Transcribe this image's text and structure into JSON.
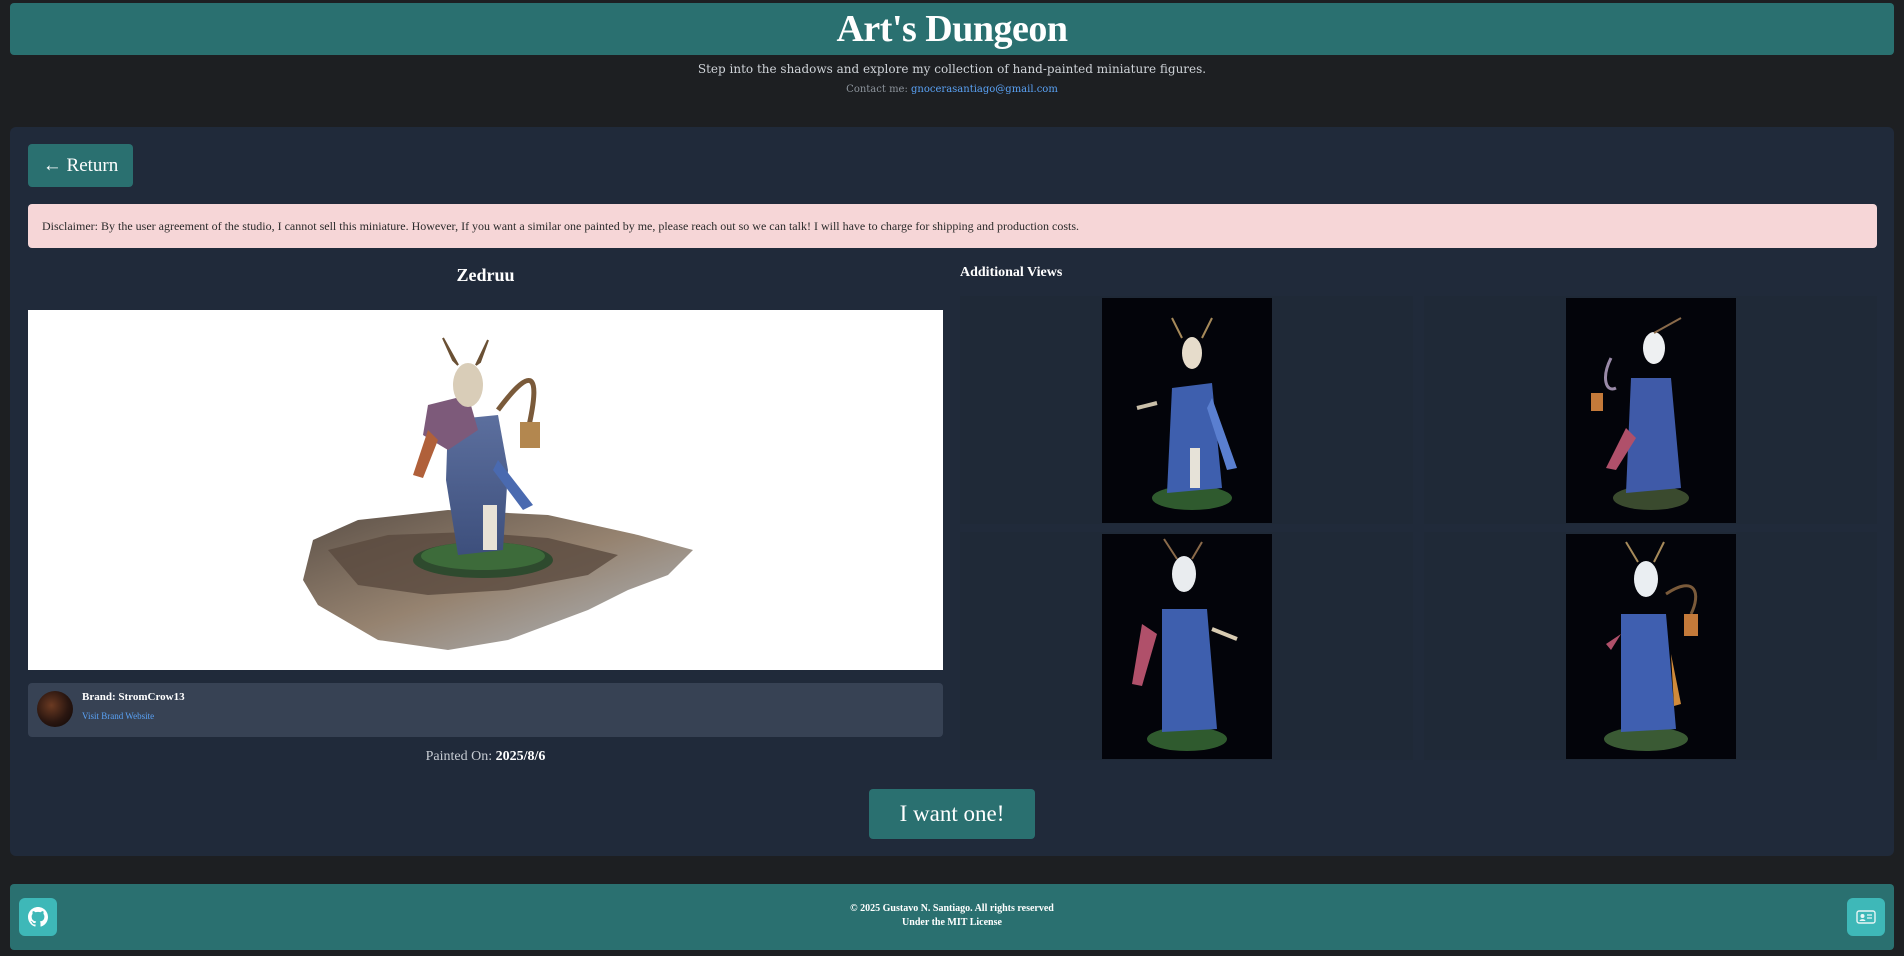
{
  "header": {
    "title": "Art's Dungeon",
    "tagline": "Step into the shadows and explore my collection of hand-painted miniature figures.",
    "contact_label": "Contact me:",
    "contact_email": "gnocerasantiago@gmail.com"
  },
  "panel": {
    "return_label": "← Return",
    "disclaimer": "Disclaimer: By the user agreement of the studio, I cannot sell this miniature. However, If you want a similar one painted by me, please reach out so we can talk! I will have to charge for shipping and production costs.",
    "figure_name": "Zedruu",
    "brand_name": "Brand: StromCrow13",
    "brand_link": "Visit Brand Website",
    "painted_label": "Painted On:",
    "painted_date": "2025/8/6",
    "additional_views_title": "Additional Views",
    "want_label": "I want one!"
  },
  "footer": {
    "copyright": "© 2025 Gustavo N. Santiago. All rights reserved",
    "license": "Under the MIT License",
    "left_icon": "github-icon",
    "right_icon": "contact-card-icon"
  },
  "colors": {
    "accent": "#2a7070",
    "panel": "#202a3a",
    "link": "#5aa2f5",
    "disclaimer_bg": "#f6d6d7"
  }
}
